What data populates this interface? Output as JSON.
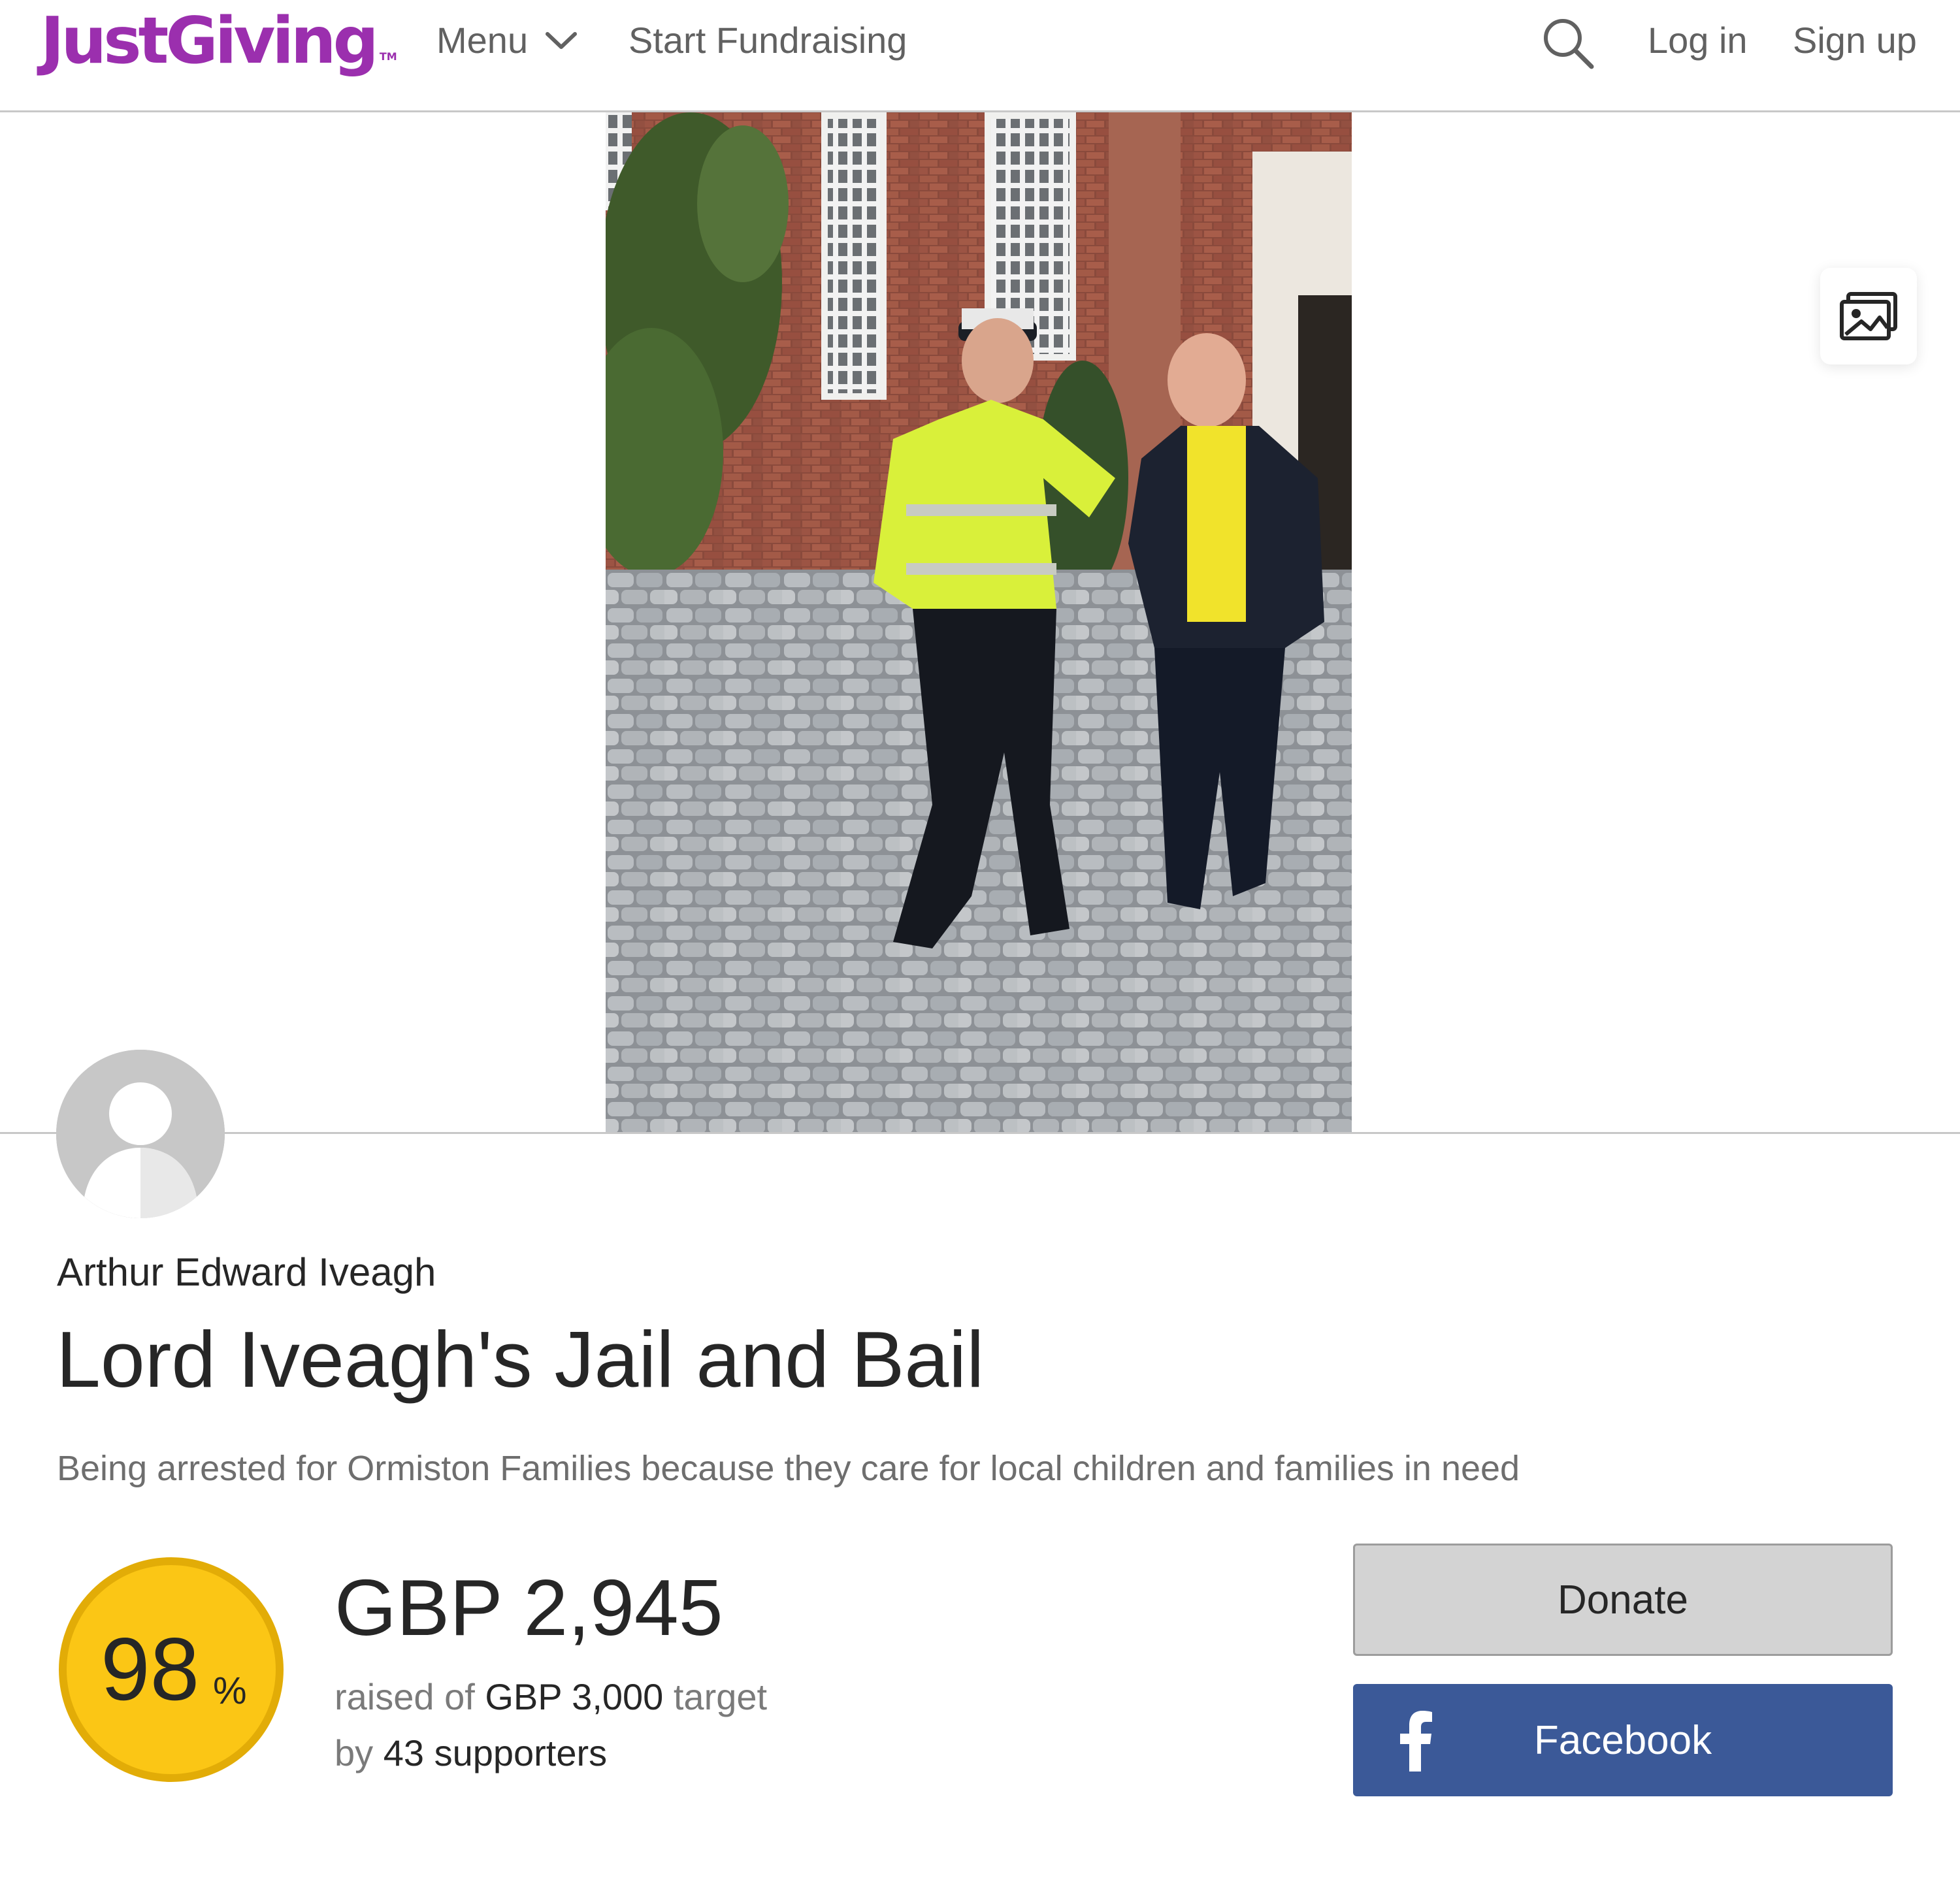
{
  "header": {
    "logo": "JustGiving",
    "logo_tm": "TM",
    "menu_label": "Menu",
    "start_fundraising": "Start Fundraising",
    "login": "Log in",
    "signup": "Sign up"
  },
  "page": {
    "owner": "Arthur Edward Iveagh",
    "title": "Lord Iveagh's Jail and Bail",
    "summary": "Being arrested for Ormiston Families because they care for local children and families in need"
  },
  "progress": {
    "percent": "98",
    "percent_sign": "%",
    "raised": "GBP 2,945",
    "raised_of_prefix": "raised of",
    "target": "GBP 3,000",
    "target_suffix": "target",
    "by_prefix": "by",
    "supporters": "43 supporters"
  },
  "actions": {
    "donate": "Donate",
    "facebook": "Facebook"
  },
  "colors": {
    "brand": "#9b2fae",
    "progress": "#fbc615",
    "facebook": "#3b5998"
  }
}
